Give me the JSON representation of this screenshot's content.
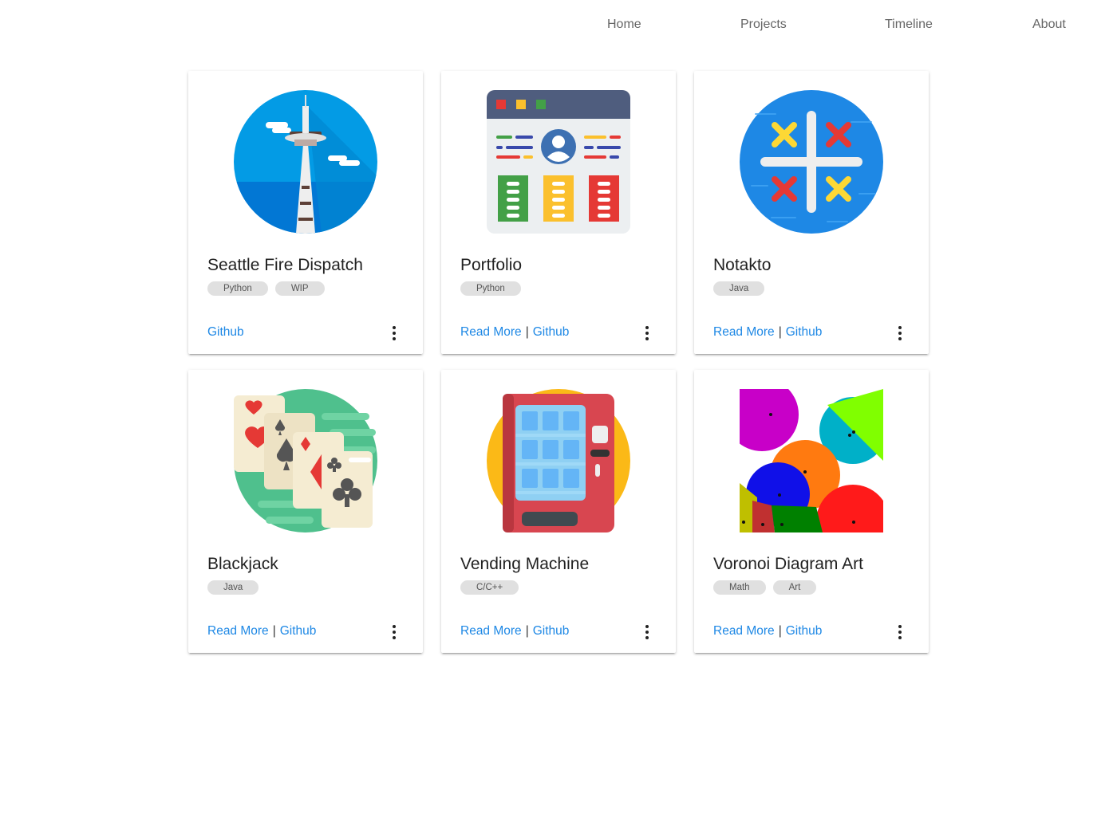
{
  "nav": {
    "home": "Home",
    "projects": "Projects",
    "timeline": "Timeline",
    "about": "About"
  },
  "cards": [
    {
      "title": "Seattle Fire Dispatch",
      "tags": [
        "Python",
        "WIP"
      ],
      "read_more": null,
      "github": "Github",
      "image_icon": "space-needle-icon"
    },
    {
      "title": "Portfolio",
      "tags": [
        "Python"
      ],
      "read_more": "Read More",
      "github": "Github",
      "image_icon": "web-profile-icon"
    },
    {
      "title": "Notakto",
      "tags": [
        "Java"
      ],
      "read_more": "Read More",
      "github": "Github",
      "image_icon": "tic-tac-toe-icon"
    },
    {
      "title": "Blackjack",
      "tags": [
        "Java"
      ],
      "read_more": "Read More",
      "github": "Github",
      "image_icon": "playing-cards-icon"
    },
    {
      "title": "Vending Machine",
      "tags": [
        "C/C++"
      ],
      "read_more": "Read More",
      "github": "Github",
      "image_icon": "vending-machine-icon"
    },
    {
      "title": "Voronoi Diagram Art",
      "tags": [
        "Math",
        "Art"
      ],
      "read_more": "Read More",
      "github": "Github",
      "image_icon": "voronoi-diagram-icon"
    }
  ],
  "separator": "|",
  "colors": {
    "link": "#1e88e5",
    "nav_text": "#666666",
    "chip_bg": "#e0e0e0"
  }
}
